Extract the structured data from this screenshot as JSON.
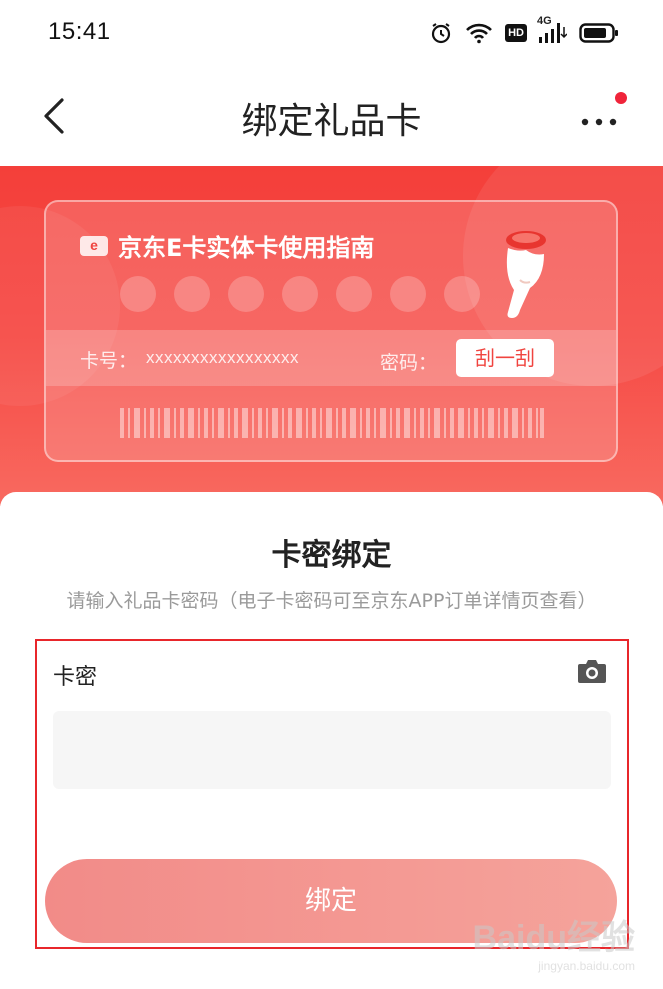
{
  "status_bar": {
    "time": "15:41",
    "hd": "HD",
    "network": "4G",
    "icons": [
      "alarm-icon",
      "wifi-icon",
      "hd-icon",
      "signal-icon",
      "battery-icon"
    ]
  },
  "nav": {
    "title": "绑定礼品卡",
    "back_icon": "back-arrow-icon",
    "more_icon": "more-dots-icon",
    "notification_dot_color": "#f0243a"
  },
  "guide_card": {
    "logo": "e",
    "title": "京东E卡实体卡使用指南",
    "card_no_label": "卡号：",
    "card_no_value": "xxxxxxxxxxxxxxxxx",
    "password_label": "密码：",
    "scratch_label": "刮一刮"
  },
  "bind_panel": {
    "title": "卡密绑定",
    "hint": "请输入礼品卡密码（电子卡密码可至京东APP订单详情页查看）",
    "field_label": "卡密",
    "input_value": "",
    "input_placeholder": "",
    "bind_label": "绑定",
    "highlight_color": "#e8262b"
  },
  "watermark": {
    "logo": "Baidu经验",
    "url": "jingyan.baidu.com"
  },
  "colors": {
    "brand_red": "#f43f3a",
    "button_start": "#f28b88",
    "button_end": "#f5a39b"
  }
}
